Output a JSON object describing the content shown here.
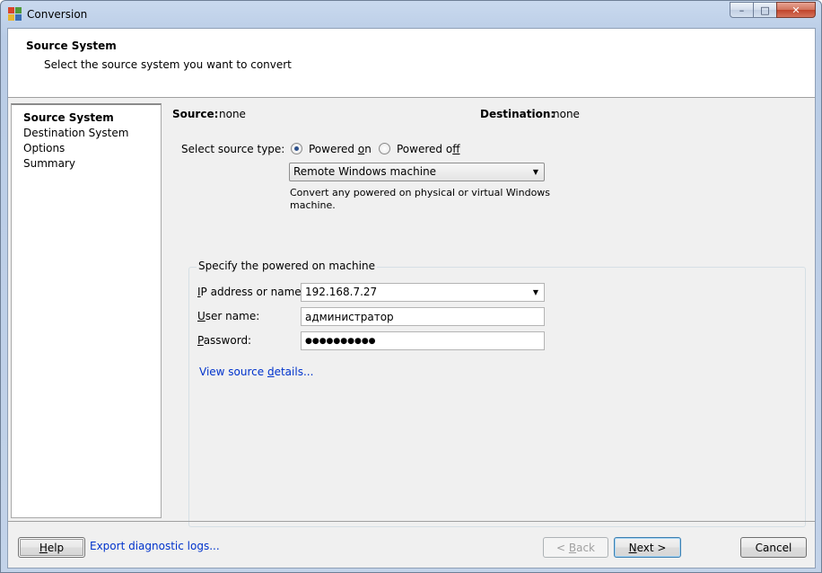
{
  "window": {
    "title": "Conversion",
    "controls": {
      "minimize": "–",
      "maximize": "□",
      "close": "✕"
    }
  },
  "header": {
    "title": "Source System",
    "subtitle": "Select the source system you want to convert"
  },
  "steps": [
    {
      "label": "Source System",
      "active": true
    },
    {
      "label": "Destination System",
      "active": false
    },
    {
      "label": "Options",
      "active": false
    },
    {
      "label": "Summary",
      "active": false
    }
  ],
  "summary": {
    "source_label": "Source:",
    "source_value": "none",
    "destination_label": "Destination:",
    "destination_value": "none"
  },
  "source_type": {
    "label": "Select source type:",
    "options": [
      {
        "label_pre": "Powered ",
        "mnemonic": "o",
        "label_post": "n",
        "checked": true
      },
      {
        "label_pre": "Powered o",
        "mnemonic": "f",
        "label_post": "f",
        "checked": false
      }
    ],
    "dropdown_value": "Remote Windows machine",
    "description_line1": "Convert any powered on physical or virtual Windows",
    "description_line2": "machine."
  },
  "machine_group": {
    "title": "Specify the powered on machine",
    "ip_label_mnemonic": "I",
    "ip_label_rest": "P address or name:",
    "ip_value": "192.168.7.27",
    "user_label_mnemonic": "U",
    "user_label_rest": "ser name:",
    "user_value": "администратор",
    "password_label_mnemonic": "P",
    "password_label_rest": "assword:",
    "password_value": "●●●●●●●●●●",
    "view_details_pre": "View source ",
    "view_details_mnemonic": "d",
    "view_details_post": "etails..."
  },
  "footer": {
    "help_mnemonic": "H",
    "help_rest": "elp",
    "export_logs": "Export diagnostic logs...",
    "back_pre": "< ",
    "back_mnemonic": "B",
    "back_rest": "ack",
    "next_mnemonic": "N",
    "next_rest": "ext >",
    "cancel": "Cancel"
  },
  "colors": {
    "accent_link": "#0033cc",
    "app_icon": [
      "#d9442a",
      "#4f9a3a",
      "#e8b530",
      "#3a6fb5"
    ]
  }
}
